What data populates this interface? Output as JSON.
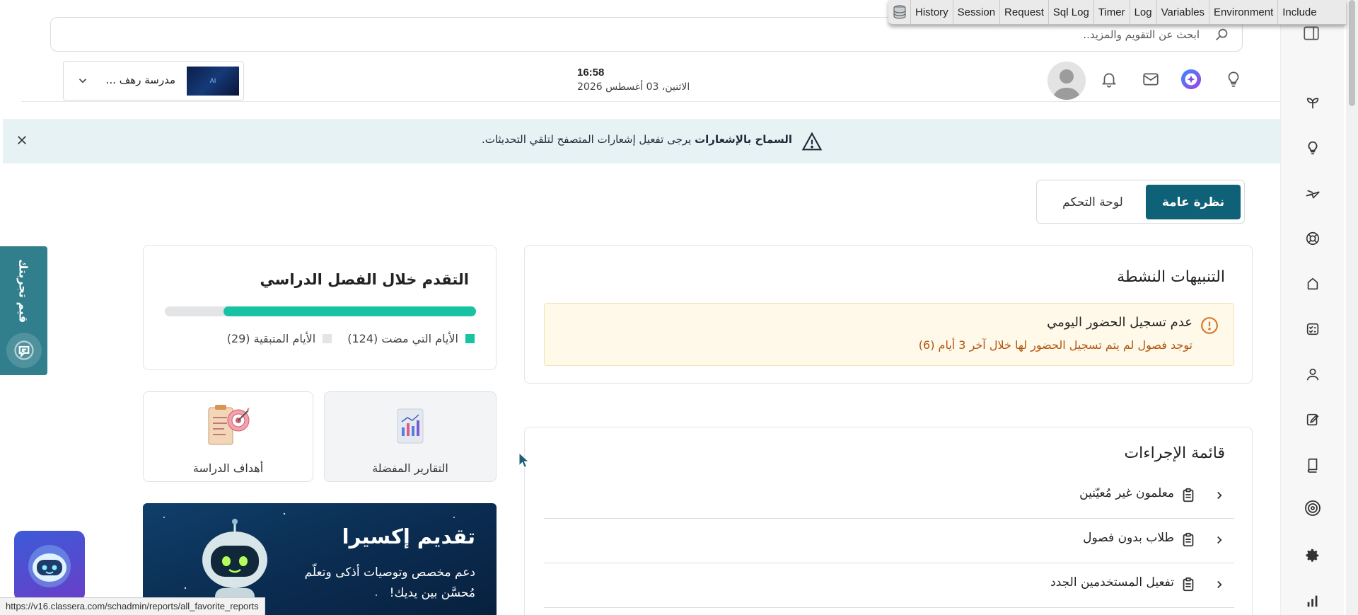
{
  "debugbar": {
    "tabs": [
      "History",
      "Session",
      "Request",
      "Sql Log",
      "Timer",
      "Log",
      "Variables",
      "Environment",
      "Include"
    ]
  },
  "search": {
    "placeholder": "ابحث عن التقويم والمزيد.."
  },
  "header": {
    "school_name": "مدرسة رهف ...",
    "time": "16:58",
    "date": "الاثنين، 03 أغسطس 2026"
  },
  "banner": {
    "title": "السماح بالإشعارات",
    "message": "يرجى تفعيل إشعارات المتصفح لتلقي التحديثات."
  },
  "tabs": {
    "overview": "نظرة عامة",
    "dashboard": "لوحة التحكم"
  },
  "alerts": {
    "title": "التنبيهات النشطة",
    "items": [
      {
        "title": "عدم تسجيل الحضور اليومي",
        "detail": "توجد فصول لم يتم تسجيل الحضور لها خلال آخر 3 أيام (6)"
      }
    ]
  },
  "progress": {
    "title": "التقدم خلال الفصل الدراسي",
    "elapsed_label": "الأيام التي مضت (124)",
    "remaining_label": "الأيام المتبقية (29)",
    "elapsed_days": 124,
    "remaining_days": 29,
    "elapsed_color": "#17c3a2",
    "remaining_color": "#e3e4e6"
  },
  "quick_links": {
    "favorite_reports": "التقارير المفضلة",
    "study_goals": "أهداف الدراسة"
  },
  "promo": {
    "title": "تقديم إكسيرا",
    "description": "دعم مخصص وتوصيات أذكى وتعلّم مُحسَّن بين يديك!"
  },
  "actions": {
    "title": "قائمة الإجراءات",
    "items": [
      "معلمون غير مُعيّنين",
      "طلاب بدون فصول",
      "تفعيل المستخدمين الجدد"
    ]
  },
  "feedback": {
    "label": "قيم تجربتك"
  },
  "status_bar": {
    "url": "https://v16.classera.com/schadmin/reports/all_favorite_reports"
  },
  "colors": {
    "primary": "#0e6177",
    "banner_bg": "#e6f2f4",
    "alert_bg": "#fef9e9",
    "alert_text": "#b4530c",
    "feedback_bg": "#317e8c"
  }
}
